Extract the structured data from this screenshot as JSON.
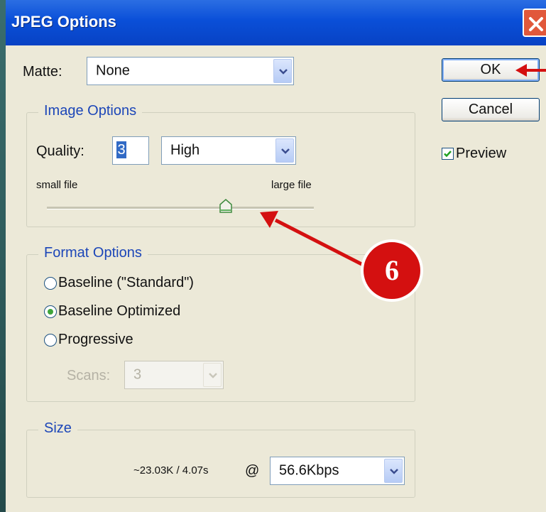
{
  "window": {
    "title": "JPEG Options"
  },
  "matte": {
    "label": "Matte:",
    "value": "None"
  },
  "buttons": {
    "ok": "OK",
    "cancel": "Cancel"
  },
  "preview": {
    "label": "Preview",
    "checked": true
  },
  "image_options": {
    "legend": "Image Options",
    "quality_label": "Quality:",
    "quality_value": "3",
    "quality_preset": "High",
    "small_file": "small file",
    "large_file": "large file",
    "slider_level": 0.67
  },
  "format_options": {
    "legend": "Format Options",
    "radios": [
      "Baseline (\"Standard\")",
      "Baseline Optimized",
      "Progressive"
    ],
    "selected_index": 1,
    "scans_label": "Scans:",
    "scans_value": "3"
  },
  "size": {
    "legend": "Size",
    "estimate": "~23.03K / 4.07s",
    "at": "@",
    "speed": "56.6Kbps"
  },
  "annotation": {
    "badge": "6",
    "color": "#d41010"
  }
}
